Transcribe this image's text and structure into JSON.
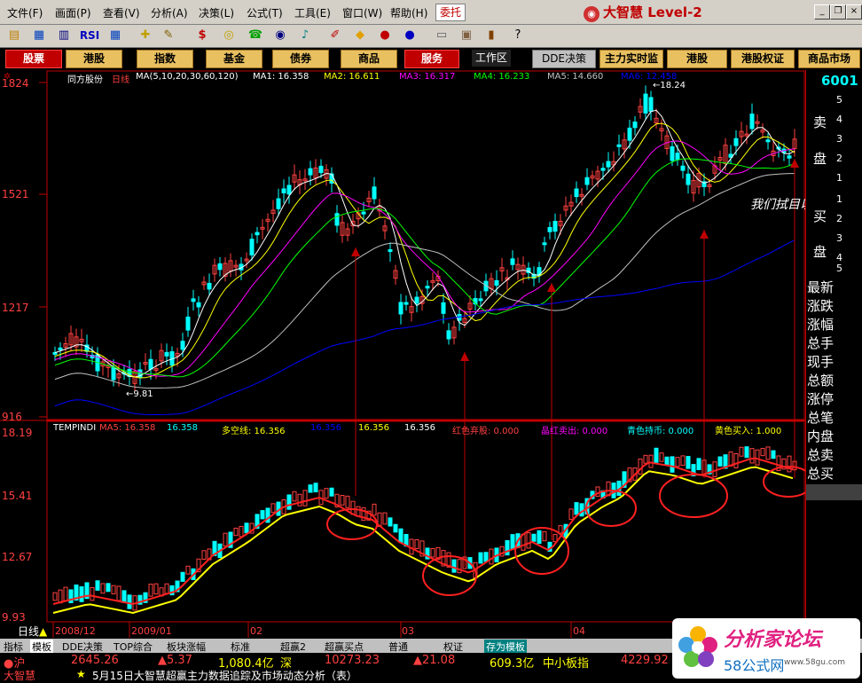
{
  "menu": [
    "文件(F)",
    "画面(P)",
    "查看(V)",
    "分析(A)",
    "决策(L)",
    "公式(T)",
    "工具(E)",
    "窗口(W)",
    "帮助(H)"
  ],
  "entrust": "委托",
  "brand": {
    "name": "大智慧",
    "level": "Level-2"
  },
  "toolbar_rsi": "RSI",
  "tabs": {
    "stock": "股票",
    "hk": "港股",
    "index": "指数",
    "fund": "基金",
    "bond": "债券",
    "commodity": "商品",
    "service": "服务",
    "workspace": "工作区",
    "dde": "DDE决策",
    "main_monitor": "主力实时监控",
    "hk2": "港股",
    "hk_warrant": "港股权证",
    "commodity_market": "商品市场"
  },
  "main_info": {
    "stock_name": "同方股份",
    "period": "日线",
    "ma_params": "MA(5,10,20,30,60,120)",
    "ma1": "MA1: 16.358",
    "ma2": "MA2: 16.611",
    "ma3": "MA3: 16.317",
    "ma4": "MA4: 16.233",
    "ma5": "MA5: 14.660",
    "ma6": "MA6: 12.458"
  },
  "price_axis": [
    "1824",
    "1521",
    "1217",
    "916"
  ],
  "marks": {
    "high": "18.24",
    "low": "9.81"
  },
  "annotation": "我们拭目以待",
  "sub_info": {
    "name": "TEMPINDI",
    "ma5": "MA5: 16.358",
    "v2": "16.358",
    "multi": "多空线: 16.356",
    "v4": "16.356",
    "v5": "16.356",
    "v6": "16.356",
    "red_sell": "红色弃股: 0.000",
    "crystal_red": "晶红卖出: 0.000",
    "cyan_hold": "青色持币: 0.000",
    "yellow_buy": "黄色买入: 1.000"
  },
  "sub_axis": [
    "18.19",
    "15.41",
    "12.67",
    "9.93"
  ],
  "date_axis": [
    "2008/12",
    "2009/01",
    "02",
    "03",
    "04"
  ],
  "right_panel": {
    "code": "6001",
    "sell_label1": "卖",
    "sell_label2": "盘",
    "buy_label1": "买",
    "buy_label2": "盘",
    "sell_nums": [
      "5",
      "4",
      "3",
      "2",
      "1"
    ],
    "buy_nums": [
      "1",
      "2",
      "3",
      "4",
      "5"
    ],
    "fields": [
      "最新",
      "涨跌",
      "涨幅",
      "总手",
      "现手",
      "总额",
      "涨停",
      "总笔",
      "内盘",
      "总卖",
      "总买"
    ]
  },
  "bottom_tabs": [
    "指标",
    "模板",
    "DDE决策",
    "TOP综合",
    "板块涨幅",
    "标准",
    "超赢2",
    "超赢买点",
    "普通",
    "权证",
    "存为模板"
  ],
  "period_label": "日线",
  "ticker": {
    "sh_label": "沪",
    "sh_value": "2645.26",
    "sh_change": "5.37",
    "sh_amount": "1,080.4亿",
    "sz_label": "深",
    "sz_value": "10273.23",
    "sz_change": "21.08",
    "sz_amount": "609.3亿",
    "sme_label": "中小板指",
    "sme_value": "4229.92",
    "news": "5月15日大智慧超赢主力数据追踪及市场动态分析（表）",
    "brand_small": "大智慧"
  },
  "watermark": {
    "title": "分析家论坛",
    "sub": "58公式网",
    "url": "www.58gu.com"
  },
  "colors": {
    "up": "#ff4040",
    "down": "#00ffff",
    "ma1": "#ffffff",
    "ma2": "#ffff00",
    "ma3": "#ff00ff",
    "ma4": "#00ff00",
    "ma5": "#c0c0c0",
    "ma6": "#0000ff",
    "accent": "#c00000"
  }
}
